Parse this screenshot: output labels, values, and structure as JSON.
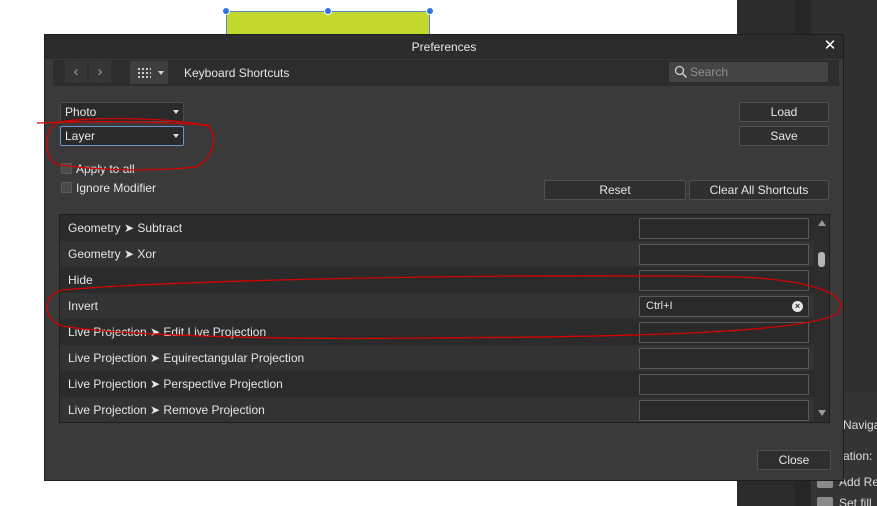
{
  "colors": {
    "dialog_bg": "#3a3a3a",
    "titlebar_bg": "#2c2c2c",
    "list_bg": "#2b2b2b",
    "shape_fill": "#c3d82e",
    "selection_handle": "#2b74e0",
    "annotation_red": "#d40000"
  },
  "background": {
    "side_panel": {
      "tab": "Navigato",
      "items": [
        {
          "label": "ation:"
        },
        {
          "label": "Add Re"
        },
        {
          "label": "Set fill"
        }
      ]
    }
  },
  "dialog": {
    "title": "Preferences",
    "close_icon": "close-icon",
    "toolbar": {
      "back_icon": "chevron-left-icon",
      "forward_icon": "chevron-right-icon",
      "grid_icon": "grid-icon",
      "section_title": "Keyboard Shortcuts",
      "search_placeholder": "Search"
    },
    "persona_select": {
      "value": "Photo"
    },
    "category_select": {
      "value": "Layer"
    },
    "apply_to_all": {
      "label": "Apply to all",
      "checked": false
    },
    "ignore_modifier": {
      "label": "Ignore Modifier",
      "checked": false
    },
    "buttons": {
      "load": "Load",
      "save": "Save",
      "reset": "Reset",
      "clear_all": "Clear All Shortcuts",
      "close": "Close"
    },
    "shortcuts": [
      {
        "label": "Geometry ➤ Subtract",
        "shortcut": ""
      },
      {
        "label": "Geometry ➤ Xor",
        "shortcut": ""
      },
      {
        "label": "Hide",
        "shortcut": ""
      },
      {
        "label": "Invert",
        "shortcut": "Ctrl+I"
      },
      {
        "label": "Live Projection ➤ Edit Live Projection",
        "shortcut": ""
      },
      {
        "label": "Live Projection ➤ Equirectangular Projection",
        "shortcut": ""
      },
      {
        "label": "Live Projection ➤ Perspective Projection",
        "shortcut": ""
      },
      {
        "label": "Live Projection ➤ Remove Projection",
        "shortcut": ""
      }
    ]
  }
}
